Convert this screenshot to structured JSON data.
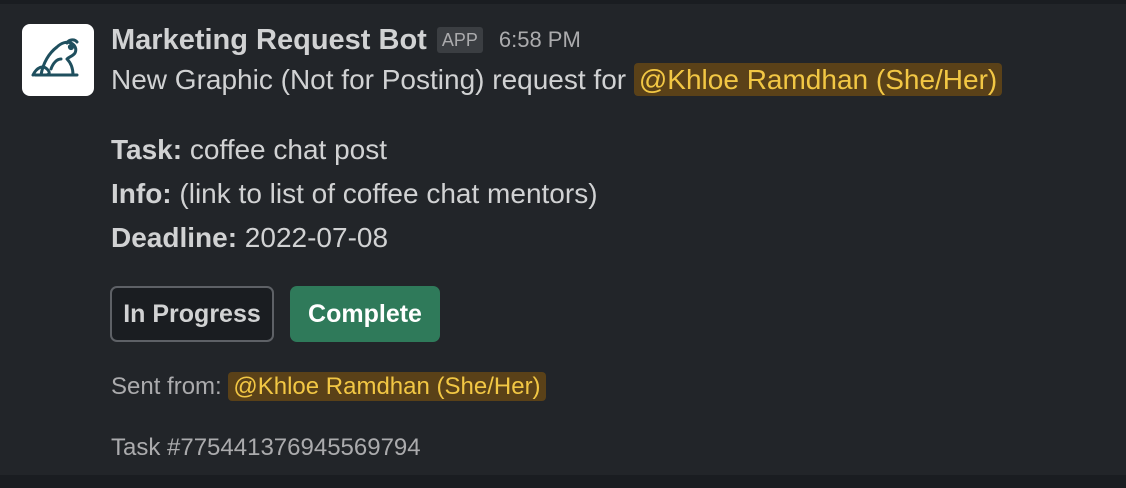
{
  "message": {
    "sender": "Marketing Request Bot",
    "badge": "APP",
    "timestamp": "6:58 PM",
    "intro_text": "New Graphic (Not for Posting) request for ",
    "intro_mention": "@Khloe Ramdhan (She/Her)",
    "avatar_icon": "frog-logo-icon"
  },
  "fields": {
    "task_label": "Task:",
    "task_value": " coffee chat post",
    "info_label": "Info:",
    "info_value": " (link to list of coffee chat mentors)",
    "deadline_label": "Deadline:",
    "deadline_value": " 2022-07-08"
  },
  "actions": {
    "in_progress_label": "In Progress",
    "complete_label": "Complete"
  },
  "footer": {
    "sent_from_label": "Sent from: ",
    "sent_from_mention": "@Khloe Ramdhan (She/Her)",
    "task_id": "Task #775441376945569794"
  },
  "colors": {
    "background": "#1a1d21",
    "message_bg": "#222529",
    "mention_bg": "#5a4118",
    "mention_text": "#f2c744",
    "complete_button": "#2f7a5a"
  }
}
